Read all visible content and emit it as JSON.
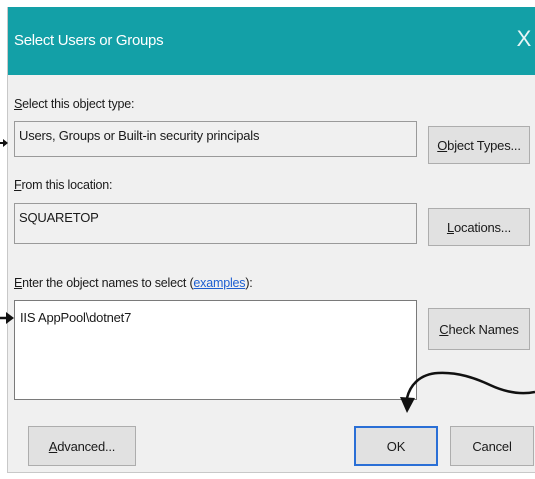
{
  "window": {
    "title": "Select Users or Groups",
    "close_glyph": "X"
  },
  "object_type": {
    "label_accel": "S",
    "label_rest": "elect this object type:",
    "value": "Users, Groups or Built-in security principals",
    "button_accel": "O",
    "button_rest": "bject Types..."
  },
  "location": {
    "label_accel": "F",
    "label_rest": "rom this location:",
    "value": "SQUARETOP",
    "button_accel": "L",
    "button_rest": "ocations..."
  },
  "names": {
    "label_accel": "E",
    "label_rest": "nter the object names to select (",
    "label_link": "examples",
    "label_end": "):",
    "value": "IIS AppPool\\dotnet7",
    "check_accel": "C",
    "check_rest": "heck Names"
  },
  "footer": {
    "advanced_accel": "A",
    "advanced_rest": "dvanced...",
    "ok_label": "OK",
    "cancel_label": "Cancel"
  },
  "colors": {
    "titlebar": "#13a0a7",
    "default_button_border": "#2a6fd6",
    "link": "#1e5fd1"
  },
  "annotations": [
    "arrow-icon",
    "arrow-icon",
    "arrow-icon"
  ]
}
